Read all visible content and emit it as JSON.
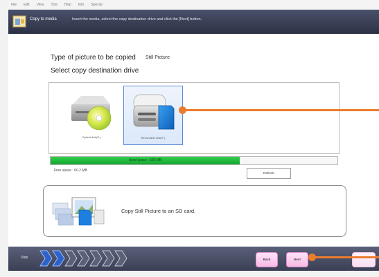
{
  "menu": {
    "items": [
      "File",
      "Edit",
      "View",
      "Tool",
      "Help",
      "Info",
      "Special"
    ]
  },
  "header": {
    "title": "Copy to media",
    "instruction": "Insert the media, select the copy destination drive and click the [Next] button."
  },
  "form": {
    "type_label": "Type of picture to be copied",
    "type_value": "Still Picture",
    "select_label": "Select copy destination drive"
  },
  "drives": [
    {
      "label": "Optical disk(E:)",
      "selected": false,
      "icon": "optical-drive-icon"
    },
    {
      "label": "Removable disk(F:)",
      "selected": true,
      "icon": "sd-card-drive-icon"
    }
  ],
  "usage": {
    "text": "Used space : 580 MB",
    "fraction_used": 0.66,
    "free_label": "Free space : 60.2 MB",
    "refresh_label": "Refresh"
  },
  "message": {
    "text": "Copy Still Picture to an SD card.",
    "icon": "copy-to-sd-card-icon"
  },
  "footer": {
    "step_label": "Step",
    "steps_total": 7,
    "steps_done": 2,
    "back_label": "Back",
    "next_label": "Next"
  },
  "colors": {
    "accent": "#ec7c2e",
    "progress": "#1fbf3f",
    "header": "#3a4058",
    "selected_border": "#5c8ad6",
    "button": "#f6b9e6"
  }
}
